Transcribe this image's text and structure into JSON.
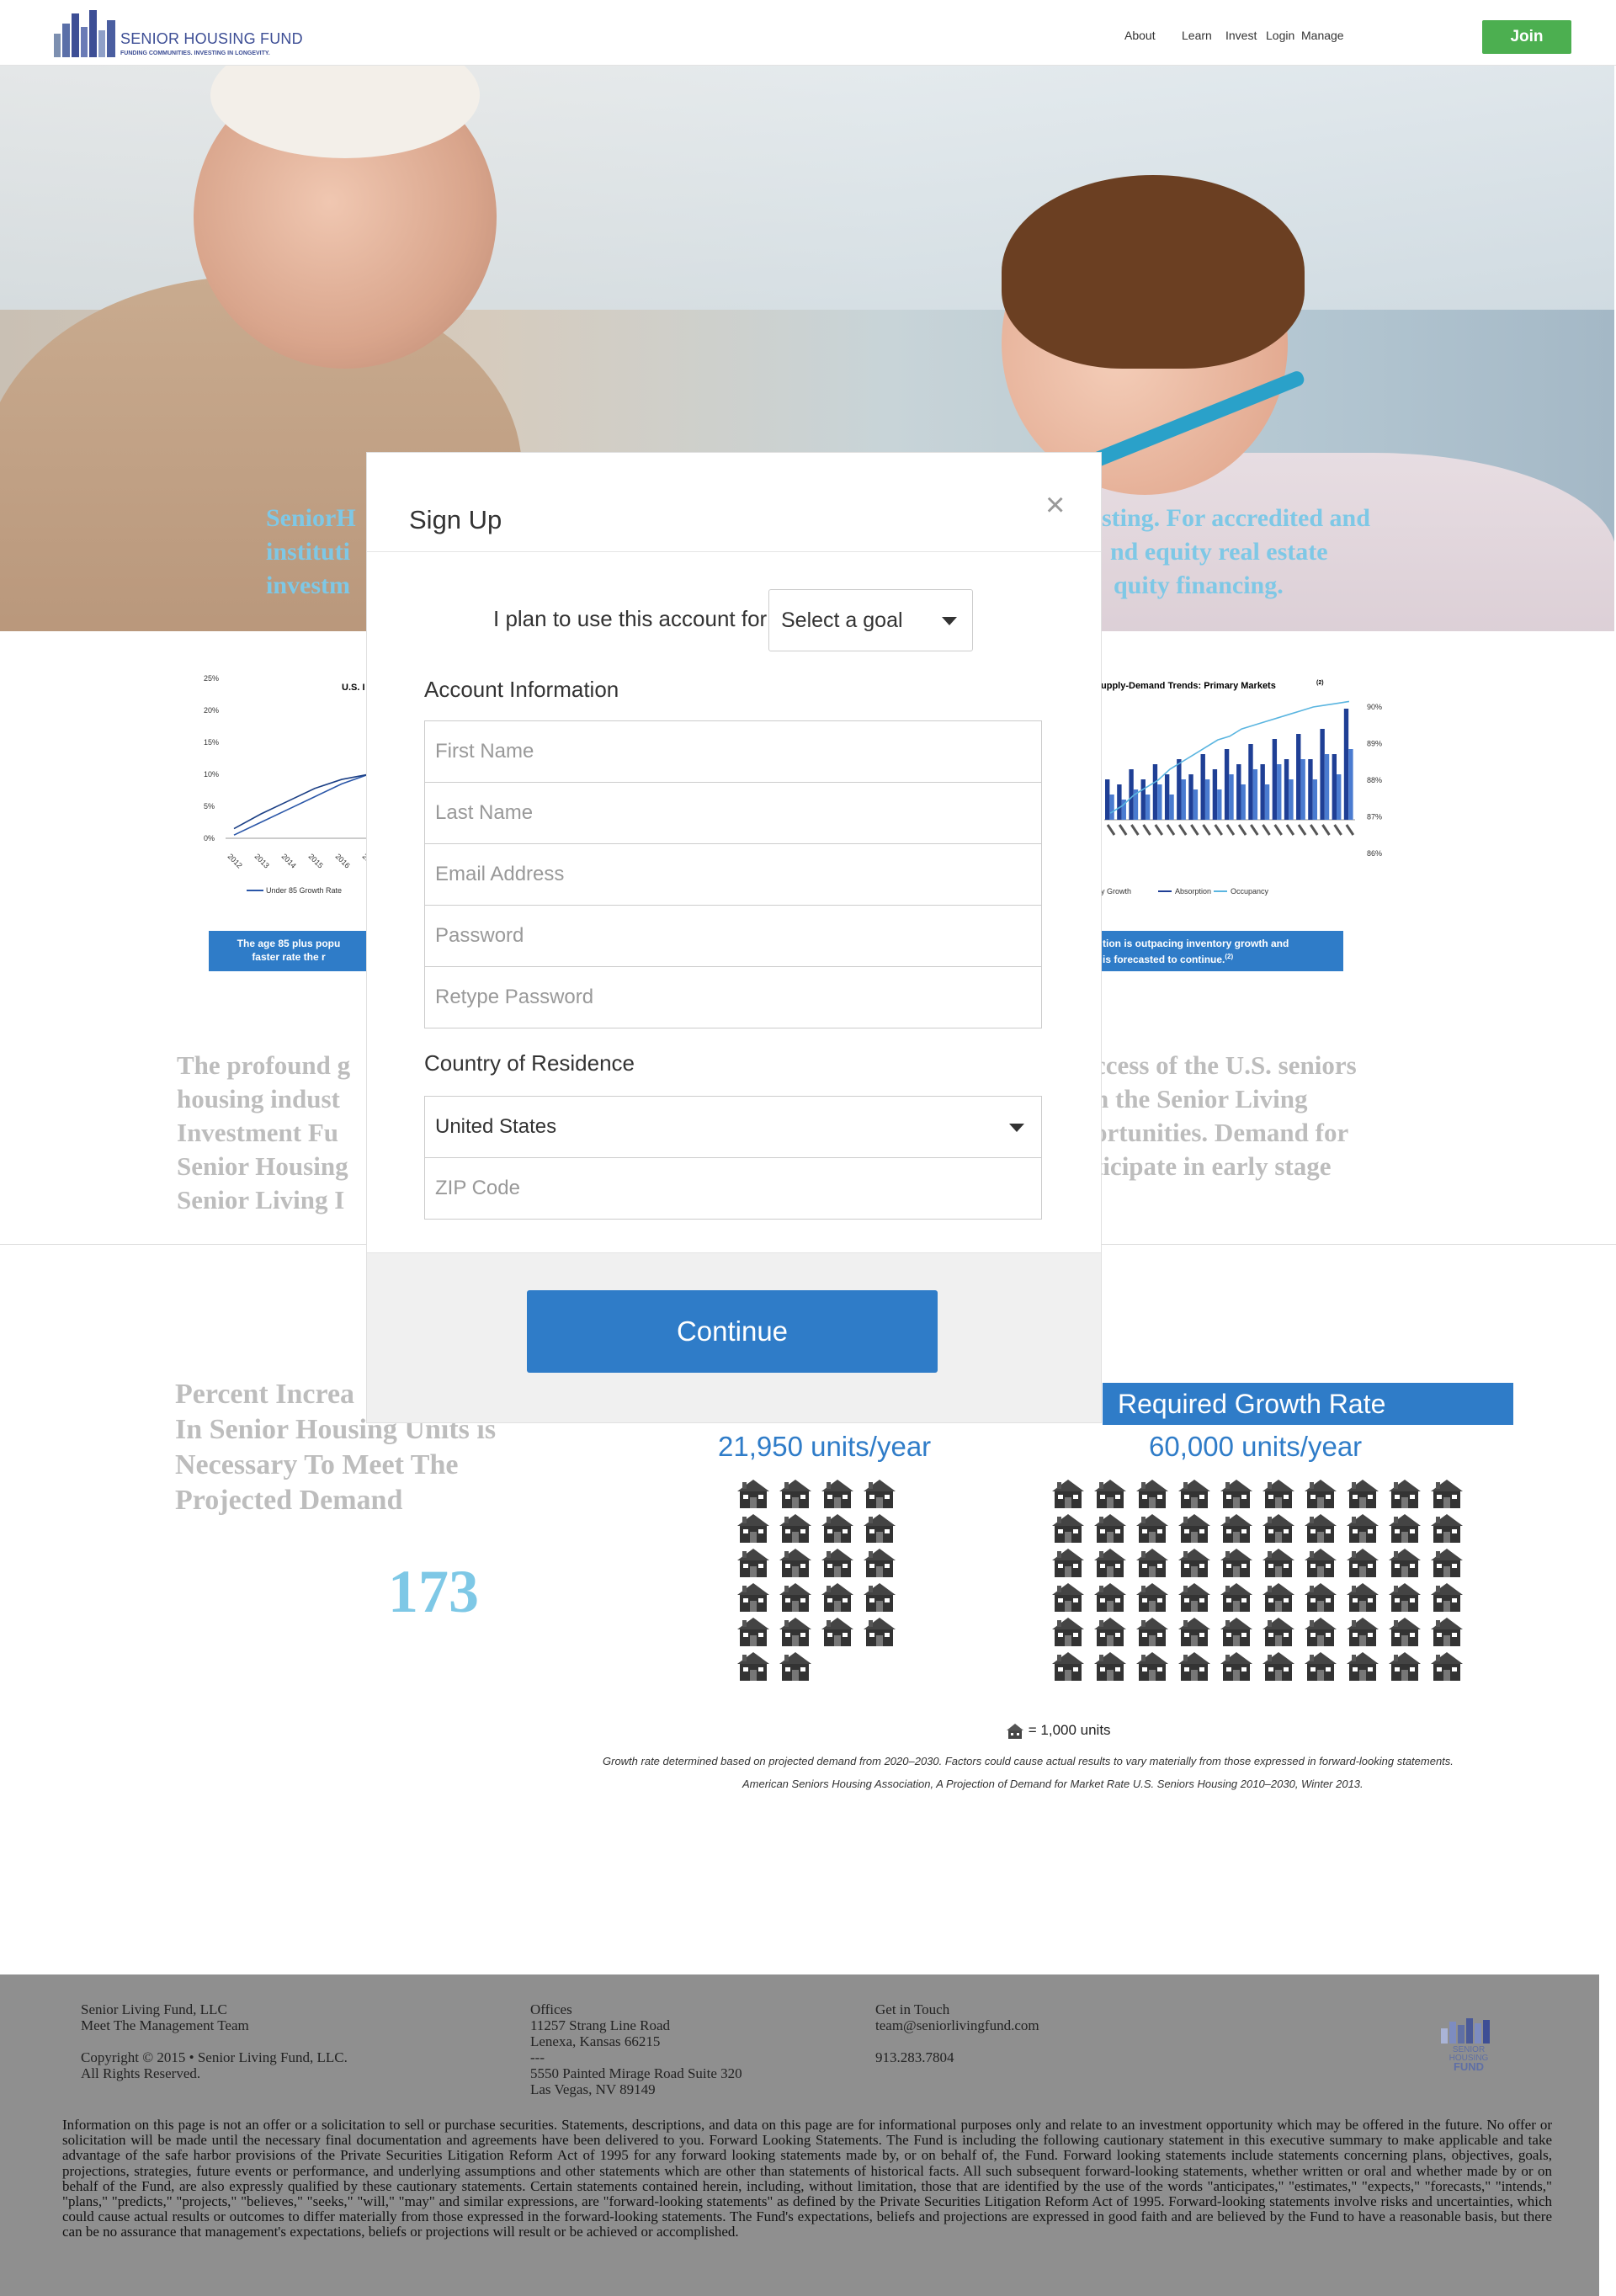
{
  "header": {
    "logo_title": "SENIOR HOUSING FUND",
    "logo_tagline": "FUNDING COMMUNITIES. INVESTING IN LONGEVITY.",
    "nav": [
      "About",
      "Learn",
      "Invest",
      "Login",
      "Manage"
    ],
    "join_label": "Join"
  },
  "hero": {
    "text_line1": "SeniorH",
    "text_line1_end": "sting. For accredited and",
    "text_line2": "instituti",
    "text_line2_end": "nd equity real estate",
    "text_line3": "investm",
    "text_line3_end": "quity financing."
  },
  "chart_left": {
    "title": "U.S. I",
    "yticks": [
      "25%",
      "20%",
      "15%",
      "10%",
      "5%",
      "0%"
    ],
    "xticks": [
      "2012",
      "2013",
      "2014",
      "2015",
      "2016",
      "20"
    ],
    "legend": "Under 85 Growth Rate",
    "banner_line1": "The age 85 plus popu",
    "banner_line2": "faster rate the r"
  },
  "chart_right": {
    "title": "upply-Demand Trends: Primary Markets",
    "title_sup": "(2)",
    "yticks_right": [
      "90%",
      "89%",
      "88%",
      "87%",
      "86%"
    ],
    "legend": [
      "y Growth",
      "Absorption",
      "Occupancy"
    ],
    "banner_line1": "tion is outpacing inventory growth and",
    "banner_line2": "is forecasted to continue.",
    "banner_sup": "(2)"
  },
  "chart_data": [
    {
      "type": "line",
      "title": "U.S. I",
      "x": [
        "2012",
        "2013",
        "2014",
        "2015",
        "2016",
        "20"
      ],
      "series": [
        {
          "name": "Under 85 Growth Rate",
          "values": [
            0.5,
            2.5,
            4.5,
            6.5,
            8.5,
            10
          ]
        },
        {
          "values": [
            1.5,
            3.8,
            5.8,
            7.8,
            9.2,
            10
          ]
        }
      ],
      "ylim": [
        0,
        25
      ]
    },
    {
      "type": "bar",
      "title": "upply-Demand Trends: Primary Markets",
      "bars_dark": [
        8,
        7,
        10,
        8,
        11,
        9,
        12,
        9,
        13,
        10,
        14,
        11,
        15,
        11,
        16,
        12,
        17,
        12,
        18,
        13,
        22
      ],
      "bars_light": [
        5,
        4,
        6,
        5,
        7,
        5,
        8,
        6,
        8,
        6,
        9,
        7,
        10,
        7,
        11,
        8,
        12,
        8,
        13,
        9,
        14
      ],
      "occupancy": [
        87.1,
        87.3,
        87.6,
        87.8,
        88.0,
        88.3,
        88.5,
        88.7,
        88.9,
        89.1,
        89.2,
        89.4,
        89.5,
        89.6,
        89.7,
        89.8,
        89.9,
        90.0,
        90.05,
        90.1,
        90.15
      ],
      "ylim_right": [
        86,
        90
      ]
    }
  ],
  "profound": {
    "lines_left": [
      "The profound g",
      "housing indust",
      "Investment Fu",
      "Senior Housing",
      "Senior Living I"
    ],
    "lines_right": [
      "ccess of the U.S. seniors",
      "n the Senior Living",
      "ortunities. Demand for",
      "ticipate in early stage",
      ""
    ]
  },
  "growth": {
    "pct_text_lines": [
      "Percent Increa",
      "In Senior Housing Units is",
      "Necessary To Meet The",
      "Projected Demand"
    ],
    "number": "173",
    "required_label": "Required Growth Rate",
    "current_units": "21,950 units/year",
    "required_units": "60,000 units/year",
    "legend_units": "= 1,000 units",
    "footnote1": "Growth rate determined based on projected demand from 2020–2030. Factors could cause actual results to vary materially from those expressed in forward-looking statements.",
    "footnote2": "American Seniors Housing Association, A Projection of Demand for Market Rate U.S. Seniors Housing 2010–2030, Winter 2013."
  },
  "footer": {
    "company": "Senior Living Fund, LLC",
    "team": "Meet The Management Team",
    "copyright": "Copyright © 2015 • Senior Living Fund, LLC.",
    "rights": "All Rights Reserved.",
    "offices_label": "Offices",
    "office1_line1": "11257 Strang Line Road",
    "office1_line2": "Lenexa, Kansas 66215",
    "separator": "---",
    "office2_line1": "5550 Painted Mirage Road Suite 320",
    "office2_line2": "Las Vegas, NV 89149",
    "contact_label": "Get in Touch",
    "email": "team@seniorlivingfund.com",
    "phone": "913.283.7804",
    "logo_text1": "SENIOR",
    "logo_text2": "HOUSING",
    "logo_text3": "FUND",
    "legal": "Information on this page is not an offer or a solicitation to sell or purchase securities. Statements, descriptions, and data on this page are for informational purposes only and relate to an investment opportunity which may be offered in the future. No offer or solicitation will be made until the necessary final documentation and agreements have been delivered to you. Forward Looking Statements. The Fund is including the following cautionary statement in this executive summary to make applicable and take advantage of the safe harbor provisions of the Private Securities Litigation Reform Act of 1995 for any forward looking statements made by, or on behalf of, the Fund. Forward looking statements include statements concerning plans, objectives, goals, projections, strategies, future events or performance, and underlying assumptions and other statements which are other than statements of historical facts. All such subsequent forward-looking statements, whether written or oral and whether made by or on behalf of the Fund, are also expressly qualified by these cautionary statements. Certain statements contained herein, including, without limitation, those that are identified by the use of the words \"anticipates,\" \"estimates,\" \"expects,\" \"forecasts,\" \"intends,\" \"plans,\" \"predicts,\" \"projects,\" \"believes,\" \"seeks,\" \"will,\" \"may\" and similar expressions, are \"forward-looking statements\" as defined by the Private Securities Litigation Reform Act of 1995. Forward-looking statements involve risks and uncertainties, which could cause actual results or outcomes to differ materially from those expressed in the forward-looking statements. The Fund's expectations, beliefs and projections are expressed in good faith and are believed by the Fund to have a reasonable basis, but there can be no assurance that management's expectations, beliefs or projections will result or be achieved or accomplished."
  },
  "modal": {
    "title": "Sign Up",
    "close": "×",
    "goal_label": "I plan to use this account for",
    "goal_select": "Select a goal",
    "account_label": "Account Information",
    "first_name_placeholder": "First Name",
    "last_name_placeholder": "Last Name",
    "email_placeholder": "Email Address",
    "password_placeholder": "Password",
    "retype_placeholder": "Retype Password",
    "country_label": "Country of Residence",
    "country_value": "United States",
    "zip_placeholder": "ZIP Code",
    "continue_label": "Continue"
  },
  "colors": {
    "brand_blue": "#2f7cc8",
    "join_green": "#4caf50",
    "hero_text": "#7ec8e6",
    "muted_text": "#bdbdbd"
  }
}
